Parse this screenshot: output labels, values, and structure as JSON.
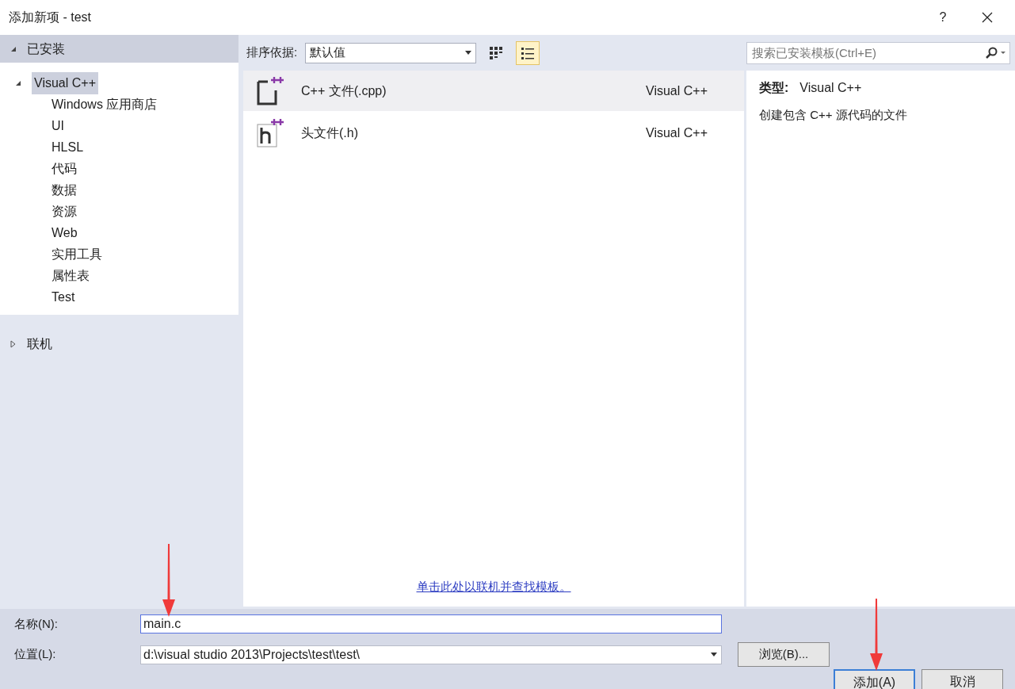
{
  "window": {
    "title": "添加新项 - test",
    "help": "?"
  },
  "tree": [
    {
      "label": "已安装",
      "expanded": true,
      "children": [
        {
          "label": "Visual C++",
          "expanded": true,
          "selected": true,
          "children": [
            {
              "label": "Windows 应用商店"
            },
            {
              "label": "UI"
            },
            {
              "label": "HLSL"
            },
            {
              "label": "代码"
            },
            {
              "label": "数据"
            },
            {
              "label": "资源"
            },
            {
              "label": "Web"
            },
            {
              "label": "实用工具"
            },
            {
              "label": "属性表"
            },
            {
              "label": "Test"
            }
          ]
        }
      ]
    },
    {
      "label": "联机",
      "expanded": false
    }
  ],
  "toolbar": {
    "sort_label": "排序依据:",
    "sort_value": "默认值",
    "views": [
      {
        "kind": "grid",
        "selected": false
      },
      {
        "kind": "list",
        "selected": true
      }
    ],
    "search": {
      "placeholder": "搜索已安装模板(Ctrl+E)"
    }
  },
  "templates": [
    {
      "kind": "cpp",
      "name": "C++ 文件(.cpp)",
      "language": "Visual C++",
      "selected": true
    },
    {
      "kind": "header",
      "name": "头文件(.h)",
      "language": "Visual C++",
      "selected": false
    }
  ],
  "online_link": "单击此处以联机并查找模板。",
  "details": {
    "type_label": "类型:",
    "type_value": "Visual C++",
    "description": "创建包含 C++ 源代码的文件"
  },
  "form": {
    "name_label": "名称(N):",
    "name_value": "main.c",
    "location_label": "位置(L):",
    "location_value": "d:\\visual studio 2013\\Projects\\test\\test\\",
    "browse": "浏览(B)..."
  },
  "buttons": [
    {
      "label": "添加(A)",
      "default": true
    },
    {
      "label": "取消",
      "default": false
    }
  ]
}
